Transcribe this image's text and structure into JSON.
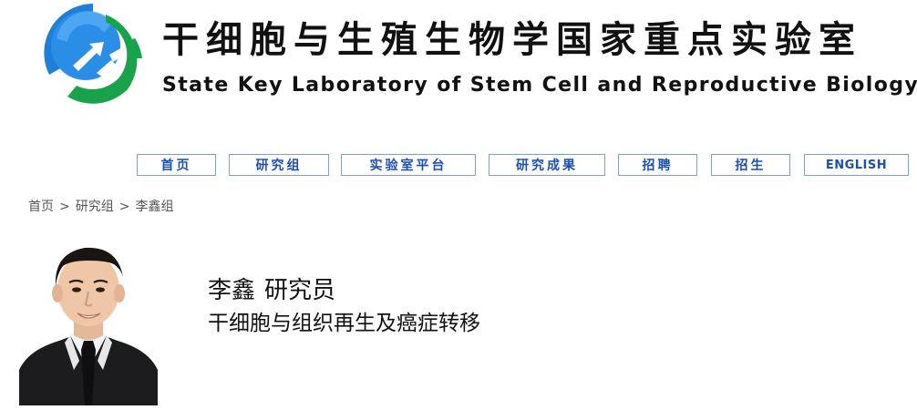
{
  "header": {
    "title_cn": "干细胞与生殖生物学国家重点实验室",
    "title_en": "State Key Laboratory of Stem Cell and Reproductive Biology",
    "logo_icon": "lab-logo-icon",
    "colors": {
      "logo_blue": "#1f7fd6",
      "logo_green": "#18a34a"
    }
  },
  "nav": {
    "items": [
      {
        "label": "首页"
      },
      {
        "label": "研究组"
      },
      {
        "label": "实验室平台"
      },
      {
        "label": "研究成果"
      },
      {
        "label": "招聘"
      },
      {
        "label": "招生"
      },
      {
        "label": "ENGLISH"
      }
    ],
    "colors": {
      "text": "#1b4fb8",
      "border": "#7aa0cf"
    }
  },
  "breadcrumb": {
    "items": [
      "首页",
      "研究组",
      "李鑫组"
    ],
    "separator": ">"
  },
  "profile": {
    "name": "李鑫",
    "title": "研究员",
    "field": "干细胞与组织再生及癌症转移",
    "photo_icon": "portrait-photo"
  }
}
